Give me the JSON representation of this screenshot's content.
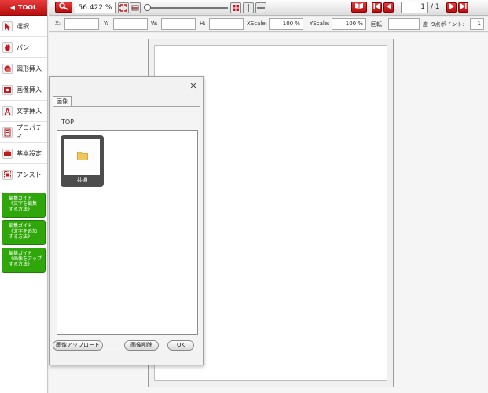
{
  "sidebar": {
    "header_label": "TOOL",
    "items": [
      {
        "label": "選択",
        "icon": "cursor-icon"
      },
      {
        "label": "パン",
        "icon": "hand-icon"
      },
      {
        "label": "図形挿入",
        "icon": "shape-icon"
      },
      {
        "label": "画像挿入",
        "icon": "image-icon"
      },
      {
        "label": "文字挿入",
        "icon": "text-icon"
      },
      {
        "label": "プロパティ",
        "icon": "properties-icon"
      },
      {
        "label": "基本設定",
        "icon": "settings-icon"
      },
      {
        "label": "アシスト",
        "icon": "assist-icon"
      }
    ],
    "guides": [
      {
        "lines": [
          "編集ガイド",
          "《文字を編集",
          "する方法》"
        ]
      },
      {
        "lines": [
          "編集ガイド",
          "《文字を追加",
          "する方法》"
        ]
      },
      {
        "lines": [
          "編集ガイド",
          "《画像をアップ",
          "する方法》"
        ]
      }
    ]
  },
  "toolbar": {
    "zoom_value": "56.422 %",
    "page_current": "1",
    "page_total": "/ 1",
    "accent_color": "#c81e1e"
  },
  "propbar": {
    "x_label": "X:",
    "x_value": "",
    "y_label": "Y:",
    "y_value": "",
    "w_label": "W:",
    "w_value": "",
    "h_label": "H:",
    "h_value": "",
    "xscale_label": "XScale:",
    "xscale_value": "100 %",
    "yscale_label": "YScale:",
    "yscale_value": "100 %",
    "rotate_label": "回転:",
    "rotate_value": "",
    "rotate_unit": "度",
    "points_label": "9点ポイント:",
    "points_value": "1"
  },
  "dialog": {
    "tab_label": "画像",
    "path_label": "TOP",
    "folder_name": "共通",
    "upload_button": "画像アップロード",
    "delete_button": "画像削除",
    "ok_button": "OK",
    "close_symbol": "✕"
  }
}
